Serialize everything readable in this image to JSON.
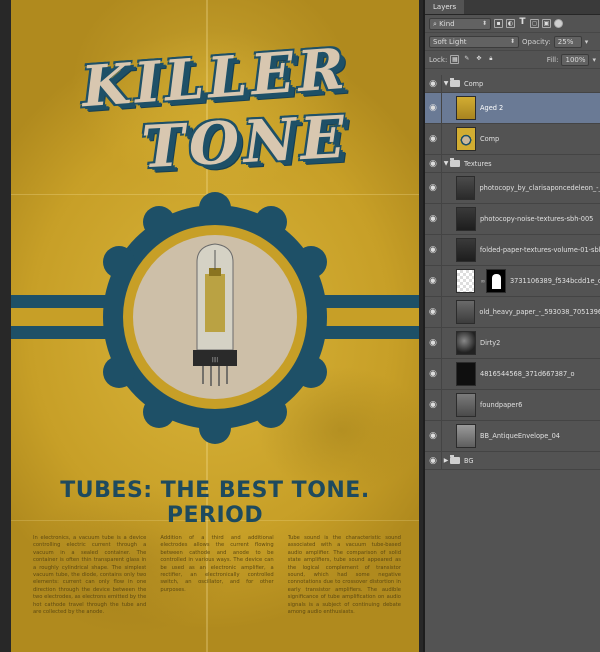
{
  "poster": {
    "title_line1": "KILLER",
    "title_line2": "TONE",
    "tagline": "TUBES: THE BEST TONE. PERIOD",
    "column1": "In electronics, a vacuum tube is a device controlling electric current through a vacuum in a sealed container. The container is often thin transparent glass in a roughly cylindrical shape. The simplest vacuum tube, the diode, contains only two elements: current can only flow in one direction through the device between the two electrodes, as electrons emitted by the hot cathode travel through the tube and are collected by the anode.",
    "column2": "Addition of a third and additional electrodes allows the current flowing between cathode and anode to be controlled in various ways. The device can be used as an electronic amplifier, a rectifier, an electronically controlled switch, an oscillator, and for other purposes.",
    "column3": "Tube sound is the characteristic sound associated with a vacuum tube-based audio amplifier. The comparison of solid state amplifiers, tube sound appeared as the logical complement of transistor sound, which had some negative connotations due to crossover distortion in early transistor amplifiers. The audible significance of tube amplification on audio signals is a subject of continuing debate among audio enthusiasts."
  },
  "panel": {
    "tab": "Layers",
    "filter_kind": "Kind",
    "filter_icons": [
      "image-filter-icon",
      "adjustment-filter-icon",
      "text-filter-icon",
      "shape-filter-icon",
      "smart-object-filter-icon",
      "filter-toggle-icon"
    ],
    "blend_mode": "Soft Light",
    "opacity_label": "Opacity:",
    "opacity_value": "25%",
    "lock_label": "Lock:",
    "fill_label": "Fill:",
    "fill_value": "100%"
  },
  "layers": {
    "comp_group": "Comp",
    "aged2": "Aged 2",
    "comp": "Comp",
    "textures_group": "Textures",
    "t1": "photocopy_by_clarisaponcedeleon_-_",
    "t2": "photocopy-noise-textures-sbh-005",
    "t3": "folded-paper-textures-volume-01-sbl",
    "t4": "3731106389_f534bcdd1e_o",
    "t5": "old_heavy_paper_-_593038_7051396",
    "t6": "Dirty2",
    "t7": "4816544568_371d667387_o",
    "t8": "foundpaper6",
    "t9": "BB_AntiqueEnvelope_04",
    "bg_group": "BG"
  },
  "colors": {
    "poster_yellow": "#c79f27",
    "poster_blue": "#1e5067",
    "panel_bg": "#535353",
    "selection": "#6a7a95"
  }
}
